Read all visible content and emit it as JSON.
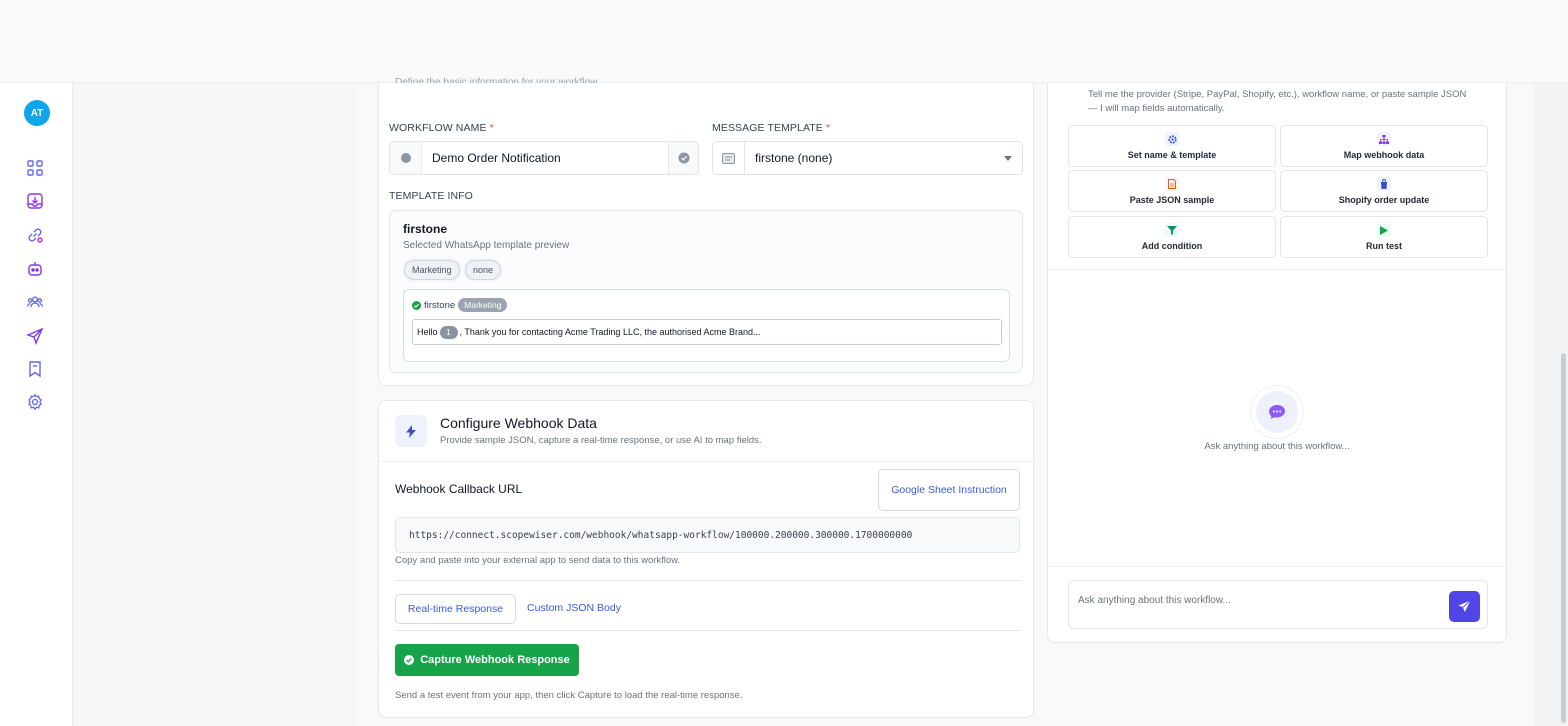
{
  "user": {
    "initials": "AT"
  },
  "nav": {
    "icons": [
      "dashboard-icon",
      "inbox-download-icon",
      "link-settings-icon",
      "bot-icon",
      "contacts-icon",
      "send-icon",
      "bookmark-icon",
      "settings-icon"
    ]
  },
  "section": {
    "cut_description": "Define the basic information for your workflow."
  },
  "workflow_name": {
    "label": "WORKFLOW NAME",
    "required_mark": "*",
    "value": "Demo Order Notification"
  },
  "message_template": {
    "label": "MESSAGE TEMPLATE",
    "required_mark": "*",
    "value": "firstone (none)"
  },
  "template_info": {
    "label": "TEMPLATE INFO",
    "name": "firstone",
    "subtitle": "Selected WhatsApp template preview",
    "chips": [
      "Marketing",
      "none"
    ],
    "preview": {
      "name": "firstone",
      "category": "Marketing",
      "body_prefix": "Hello",
      "variable": "1",
      "body_suffix": ", Thank you for contacting Acme Trading LLC, the authorised Acme Brand..."
    }
  },
  "webhook": {
    "title": "Configure Webhook Data",
    "subtitle": "Provide sample JSON, capture a real-time response, or use AI to map fields.",
    "callback_label": "Webhook Callback URL",
    "instruction_button": "Google Sheet Instruction",
    "url": "https://connect.scopewiser.com/webhook/whatsapp-workflow/100000.200000.300000.1700000000",
    "url_help": "Copy and paste into your external app to send data to this workflow.",
    "tabs": [
      "Real-time Response",
      "Custom JSON Body"
    ],
    "capture_button": "Capture Webhook Response",
    "footer": "Send a test event from your app, then click Capture to load the real-time response."
  },
  "assistant": {
    "help": "Tell me the provider (Stripe, PayPal, Shopify, etc.), workflow name, or paste sample JSON — I will map fields automatically.",
    "actions": [
      {
        "label": "Set name & template",
        "icon": "gear-icon"
      },
      {
        "label": "Map webhook data",
        "icon": "sitemap-icon"
      },
      {
        "label": "Paste JSON sample",
        "icon": "file-icon"
      },
      {
        "label": "Shopify order update",
        "icon": "shopping-bag-icon"
      },
      {
        "label": "Add condition",
        "icon": "filter-icon"
      },
      {
        "label": "Run test",
        "icon": "play-icon"
      }
    ],
    "empty_text": "Ask anything about this workflow...",
    "input_placeholder": "Ask anything about this workflow..."
  },
  "colors": {
    "accent": "#4f46e5",
    "link": "#3b5bdb",
    "success": "#16a34a",
    "avatar": "#0ea5e9"
  }
}
